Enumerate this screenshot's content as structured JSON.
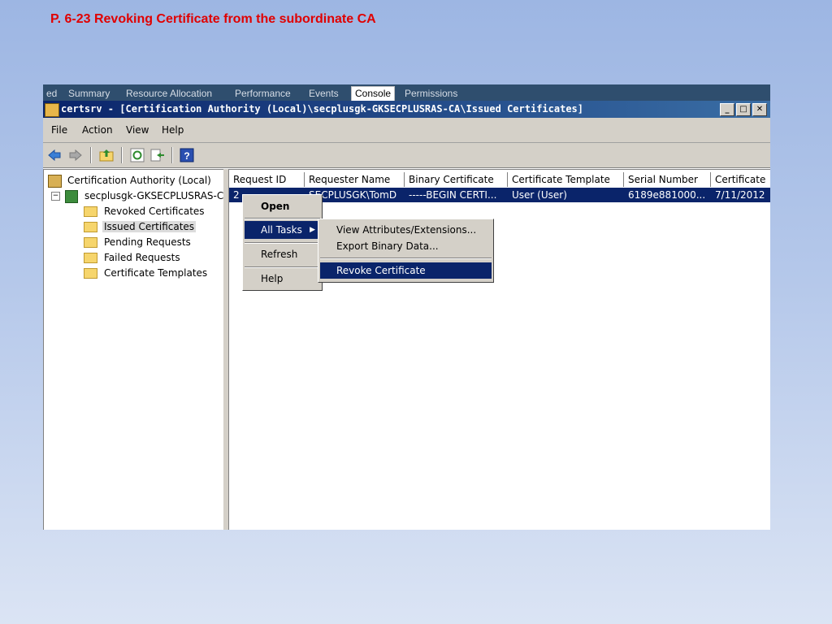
{
  "slide_title": "P. 6-23 Revoking Certificate from the subordinate CA",
  "tabs": [
    {
      "label": "ed"
    },
    {
      "label": "Summary"
    },
    {
      "label": "Resource Allocation"
    },
    {
      "label": "Performance"
    },
    {
      "label": "Events"
    },
    {
      "label": "Console",
      "active": true
    },
    {
      "label": "Permissions"
    }
  ],
  "window": {
    "title": "certsrv - [Certification Authority (Local)\\secplusgk-GKSECPLUSRAS-CA\\Issued Certificates]",
    "minimize": "_",
    "maximize": "□",
    "close": "✕"
  },
  "menu": {
    "file": "File",
    "action": "Action",
    "view": "View",
    "help": "Help"
  },
  "toolbar_icons": [
    "back-icon",
    "forward-icon",
    "up-folder-icon",
    "refresh-icon",
    "export-list-icon",
    "help-icon"
  ],
  "tree": {
    "root": "Certification Authority (Local)",
    "ca": "secplusgk-GKSECPLUSRAS-CA",
    "expander": "−",
    "folders": [
      "Revoked Certificates",
      "Issued Certificates",
      "Pending Requests",
      "Failed Requests",
      "Certificate Templates"
    ]
  },
  "list": {
    "columns": [
      "Request ID",
      "Requester Name",
      "Binary Certificate",
      "Certificate Template",
      "Serial Number",
      "Certificate"
    ],
    "row": [
      "2",
      "SECPLUSGK\\TomD",
      "-----BEGIN CERTI...",
      "User (User)",
      "6189e881000...",
      "7/11/2012"
    ]
  },
  "context_menu": {
    "open": "Open",
    "all_tasks": "All Tasks",
    "refresh": "Refresh",
    "help": "Help",
    "submenu_arrow": "▶"
  },
  "sub_menu": {
    "view_attributes": "View Attributes/Extensions...",
    "export_binary": "Export Binary Data...",
    "revoke": "Revoke Certificate"
  },
  "colors": {
    "title_red": "#e00000",
    "selection": "#0a246a",
    "chrome": "#d4d0c8"
  }
}
